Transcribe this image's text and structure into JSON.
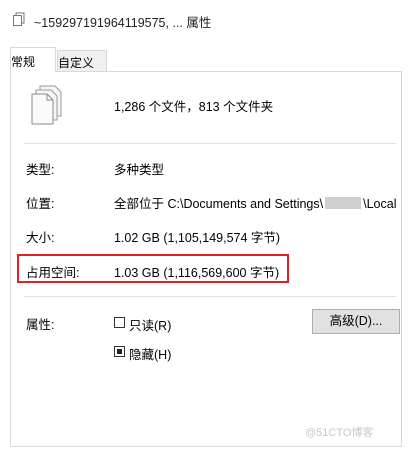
{
  "window": {
    "title": "~159297191964119575, ... 属性"
  },
  "tabs": [
    {
      "label": "常规",
      "active": true
    },
    {
      "label": "自定义",
      "active": false
    }
  ],
  "summary": "1,286 个文件，813 个文件夹",
  "rows": {
    "type": {
      "label": "类型:",
      "value": "多种类型"
    },
    "location": {
      "label": "位置:",
      "value_prefix": "全部位于 C:\\Documents and Settings\\",
      "value_suffix": "\\Local"
    },
    "size": {
      "label": "大小:",
      "value": "1.02 GB (1,105,149,574 字节)"
    },
    "size_on_disk": {
      "label": "占用空间:",
      "value": "1.03 GB (1,116,569,600 字节)"
    },
    "attributes": {
      "label": "属性:"
    }
  },
  "attributes": {
    "readonly": {
      "label": "只读(R)",
      "checked": false
    },
    "hidden": {
      "label": "隐藏(H)",
      "checked": true
    },
    "advanced_button": "高级(D)..."
  },
  "watermark": "@51CTO博客",
  "colors": {
    "highlight": "#e02020"
  }
}
